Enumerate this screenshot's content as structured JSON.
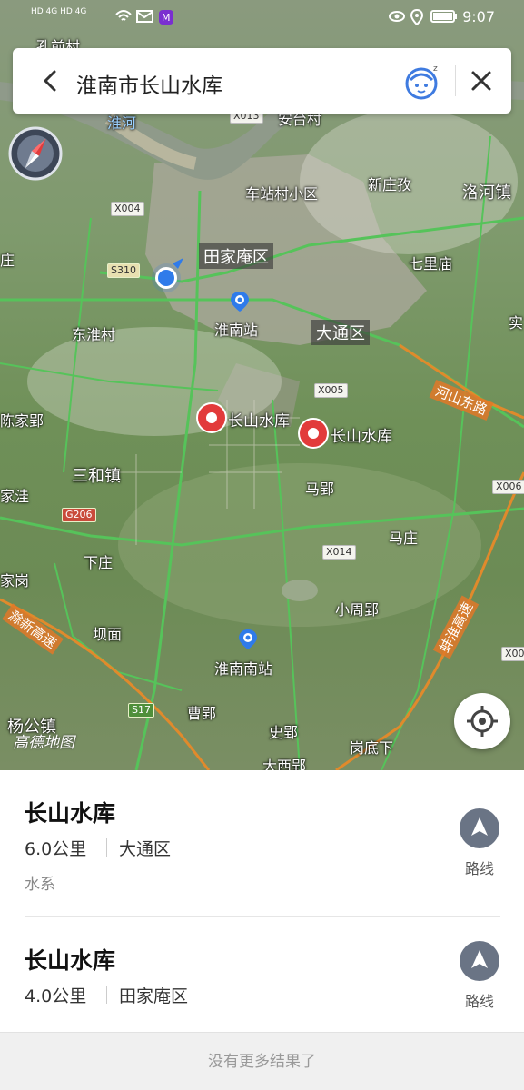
{
  "status_bar": {
    "network_left": "HD 4G HD 4G",
    "time": "9:07"
  },
  "search": {
    "query": "淮南市长山水库"
  },
  "map": {
    "districts": [
      "田家庵区",
      "大通区"
    ],
    "place_labels": [
      "孔前村",
      "车站村小区",
      "新庄孜",
      "洛河镇",
      "七里庙",
      "东淮村",
      "淮南站",
      "陈家郢",
      "三和镇",
      "马郢",
      "家洼",
      "马庄",
      "家岗",
      "下庄",
      "小周郢",
      "坝面",
      "淮南南站",
      "杨公镇",
      "曹郢",
      "史郢",
      "岗底下",
      "大西郢",
      "庄",
      "实",
      "安台村",
      "淮河"
    ],
    "road_badges": [
      "X004",
      "S310",
      "X005",
      "X014",
      "G206",
      "S17",
      "X006",
      "X00",
      "X013"
    ],
    "road_names": [
      "河山东路",
      "滁新高速",
      "蚌淮高速"
    ],
    "markers": [
      {
        "label": "长山水库"
      },
      {
        "label": "长山水库"
      }
    ],
    "logo": "高德地图"
  },
  "results": [
    {
      "name": "长山水库",
      "distance": "6.0公里",
      "district": "大通区",
      "category": "水系",
      "route_label": "路线"
    },
    {
      "name": "长山水库",
      "distance": "4.0公里",
      "district": "田家庵区",
      "category": "",
      "route_label": "路线"
    }
  ],
  "footer": "没有更多结果了",
  "colors": {
    "marker_red": "#e23b3b",
    "location_blue": "#2f7bea",
    "route_button": "#6a7485",
    "road_green": "#56c35a",
    "highway_orange": "#e08a2c"
  }
}
